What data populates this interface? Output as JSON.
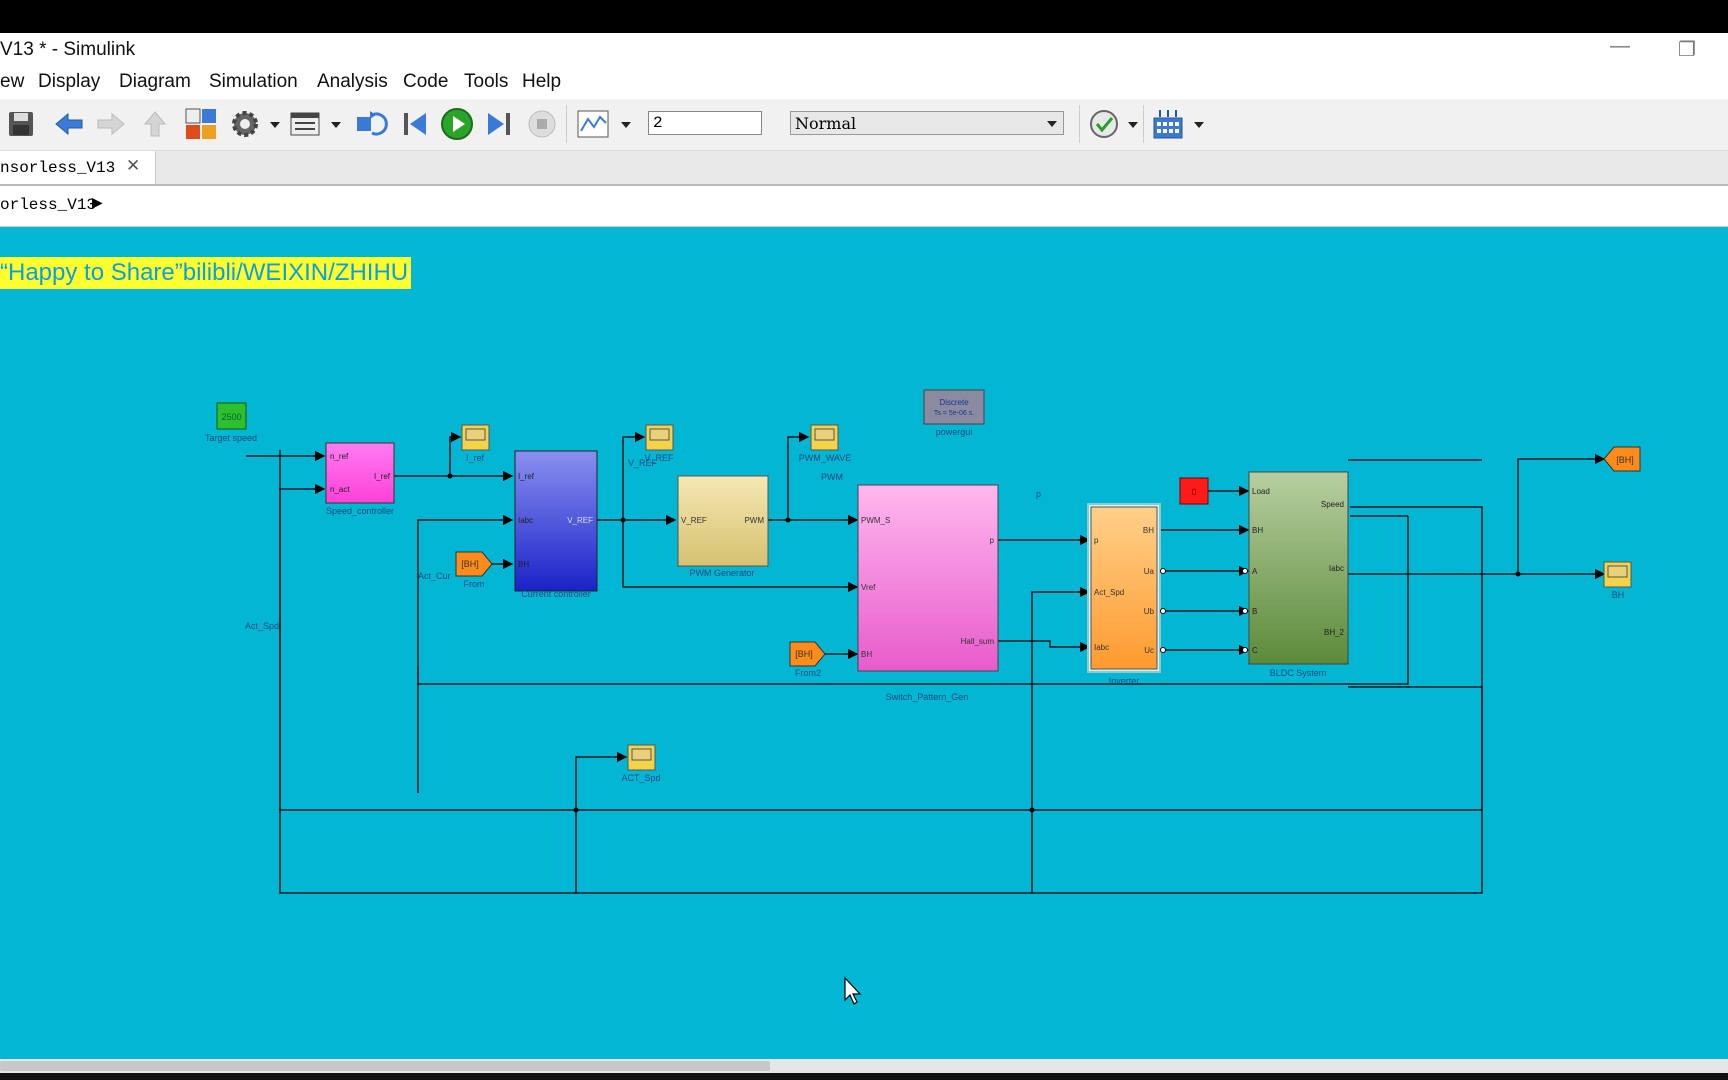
{
  "window": {
    "title": "V13 * - Simulink",
    "minimize_glyph": "—",
    "restore_glyph": "❐"
  },
  "menu": [
    "ew",
    "Display",
    "Diagram",
    "Simulation",
    "Analysis",
    "Code",
    "Tools",
    "Help"
  ],
  "toolbar": {
    "stop_time": "2",
    "sim_mode": "Normal"
  },
  "tab": {
    "label": "nsorless_V13",
    "close": "✕"
  },
  "breadcrumb": {
    "label": "orless_V13",
    "arrow": "▶"
  },
  "banner": "“Happy to Share”bilibli/WEIXIN/ZHIHU",
  "diagram": {
    "target_speed": {
      "value": "2500",
      "label": "Target speed"
    },
    "speed_controller": {
      "label": "Speed_controller",
      "in1": "n_ref",
      "in2": "n_act",
      "out": "I_ref"
    },
    "scope_iref": "I_ref",
    "current_controller": {
      "label": "Current controller",
      "in1": "I_ref",
      "in2": "Iabc",
      "in3": "BH",
      "out": "V_REF"
    },
    "from_bh": {
      "tag": "[BH]",
      "label": "From"
    },
    "scope_vref": "V_REF",
    "signal_vref": "V_REF",
    "pwm_generator": {
      "label": "PWM Generator",
      "in": "V_REF",
      "out": "PWM"
    },
    "scope_pwm": "PWM_WAVE",
    "signal_pwm": "PWM",
    "powergui": {
      "text1": "Discrete",
      "text2": "Ts = 5e-06 s.",
      "label": "powergui"
    },
    "switch_pattern": {
      "label": "Switch_Pattern_Gen",
      "in1": "PWM_S",
      "in2": "Vref",
      "in3": "BH",
      "out1": "p",
      "out2": "Hall_sum"
    },
    "signal_p": "p",
    "from_bh2": {
      "tag": "[BH]",
      "label": "From2"
    },
    "inverter": {
      "label": "Inverter",
      "in1": "p",
      "in2": "Act_Spd",
      "in3": "Iabc",
      "out1": "BH",
      "out2": "Ua",
      "out3": "Ub",
      "out4": "Uc"
    },
    "constant_load": "0",
    "bldc": {
      "label": "BLDC System",
      "in1": "Load",
      "in2": "BH",
      "in3": "A",
      "in4": "B",
      "in5": "C",
      "out1": "Speed",
      "out2": "Iabc",
      "out3": "BH_2"
    },
    "goto_bh": "[BH]",
    "scope_bh": "BH",
    "signal_act_cur": "Act_Cur",
    "signal_act_spd": "Act_Spd",
    "scope_act_spd": "ACT_Spd"
  }
}
